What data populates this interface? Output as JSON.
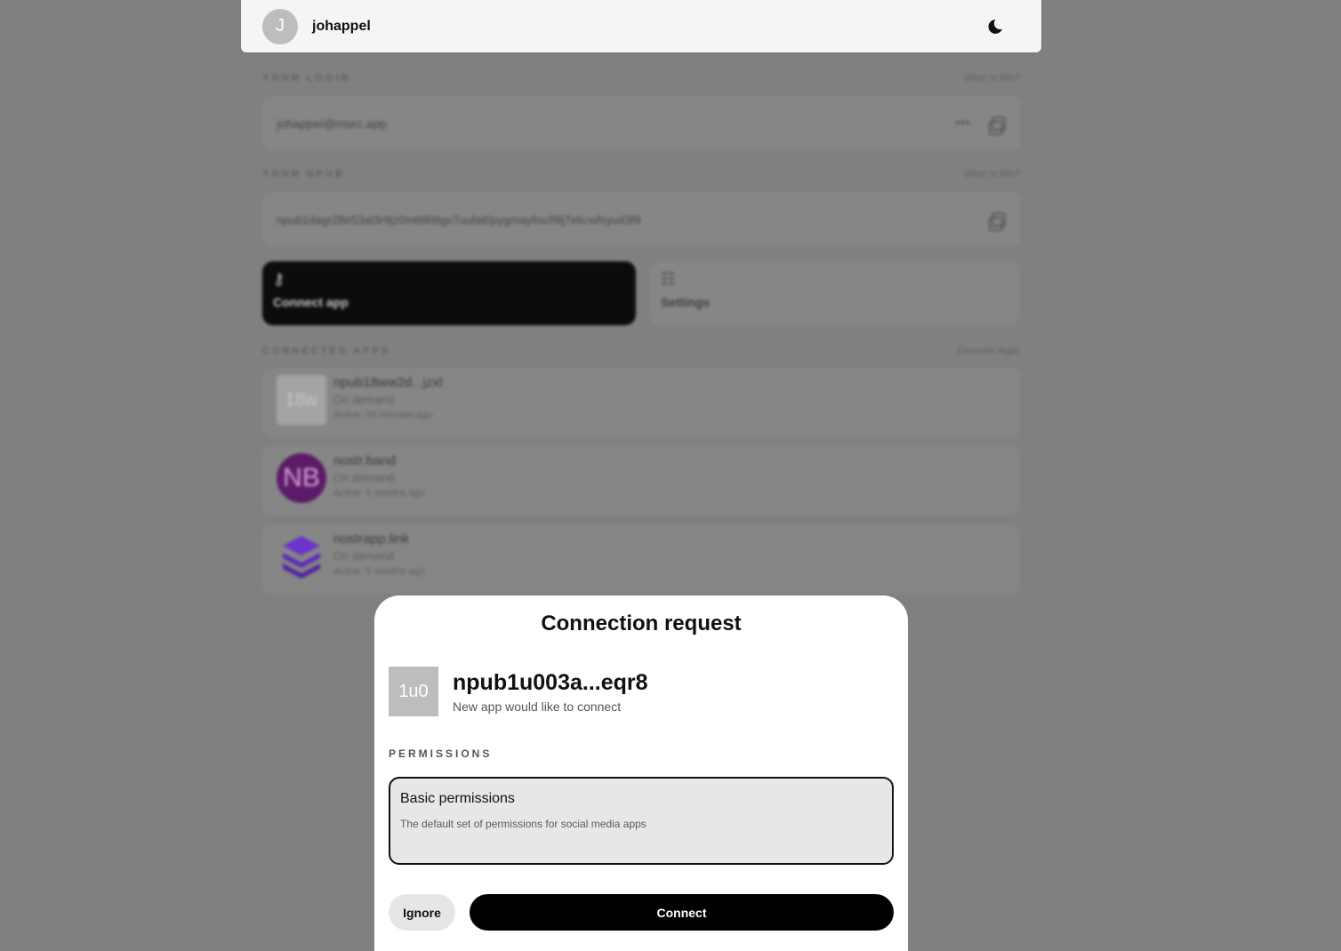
{
  "header": {
    "avatar_initial": "J",
    "username": "johappel",
    "theme_icon": "moon-icon"
  },
  "background": {
    "login": {
      "label": "YOUR LOGIN",
      "help": "What is this?",
      "value": "johappel@nsec.app",
      "more": "•••"
    },
    "npub": {
      "label": "YOUR NPUB",
      "help": "What is this?",
      "value": "npub1dagr28e53at3r9jz0mt989tgv7uufat0pygmay6scf9lj7ekcwfsyu43f9"
    },
    "tiles": {
      "connect_label": "Connect app",
      "settings_label": "Settings"
    },
    "connected": {
      "label": "CONNECTED APPS",
      "discover": "Discover Apps",
      "apps": [
        {
          "avatar": "18w",
          "name": "npub18ww2d...jzxl",
          "mode": "On demand",
          "active": "Active: 33 minutes ago"
        },
        {
          "avatar": "NB",
          "name": "nostr.band",
          "mode": "On demand",
          "active": "Active: 5 months ago"
        },
        {
          "avatar": "stack-logo-icon",
          "name": "nostrapp.link",
          "mode": "On demand",
          "active": "Active: 5 months ago"
        }
      ]
    }
  },
  "modal": {
    "title": "Connection request",
    "app_avatar": "1u0",
    "app_name": "npub1u003a...eqr8",
    "app_subtitle": "New app would like to connect",
    "permissions_label": "PERMISSIONS",
    "permission_title": "Basic permissions",
    "permission_desc": "The default set of permissions for social media apps",
    "ignore_label": "Ignore",
    "connect_label": "Connect"
  }
}
